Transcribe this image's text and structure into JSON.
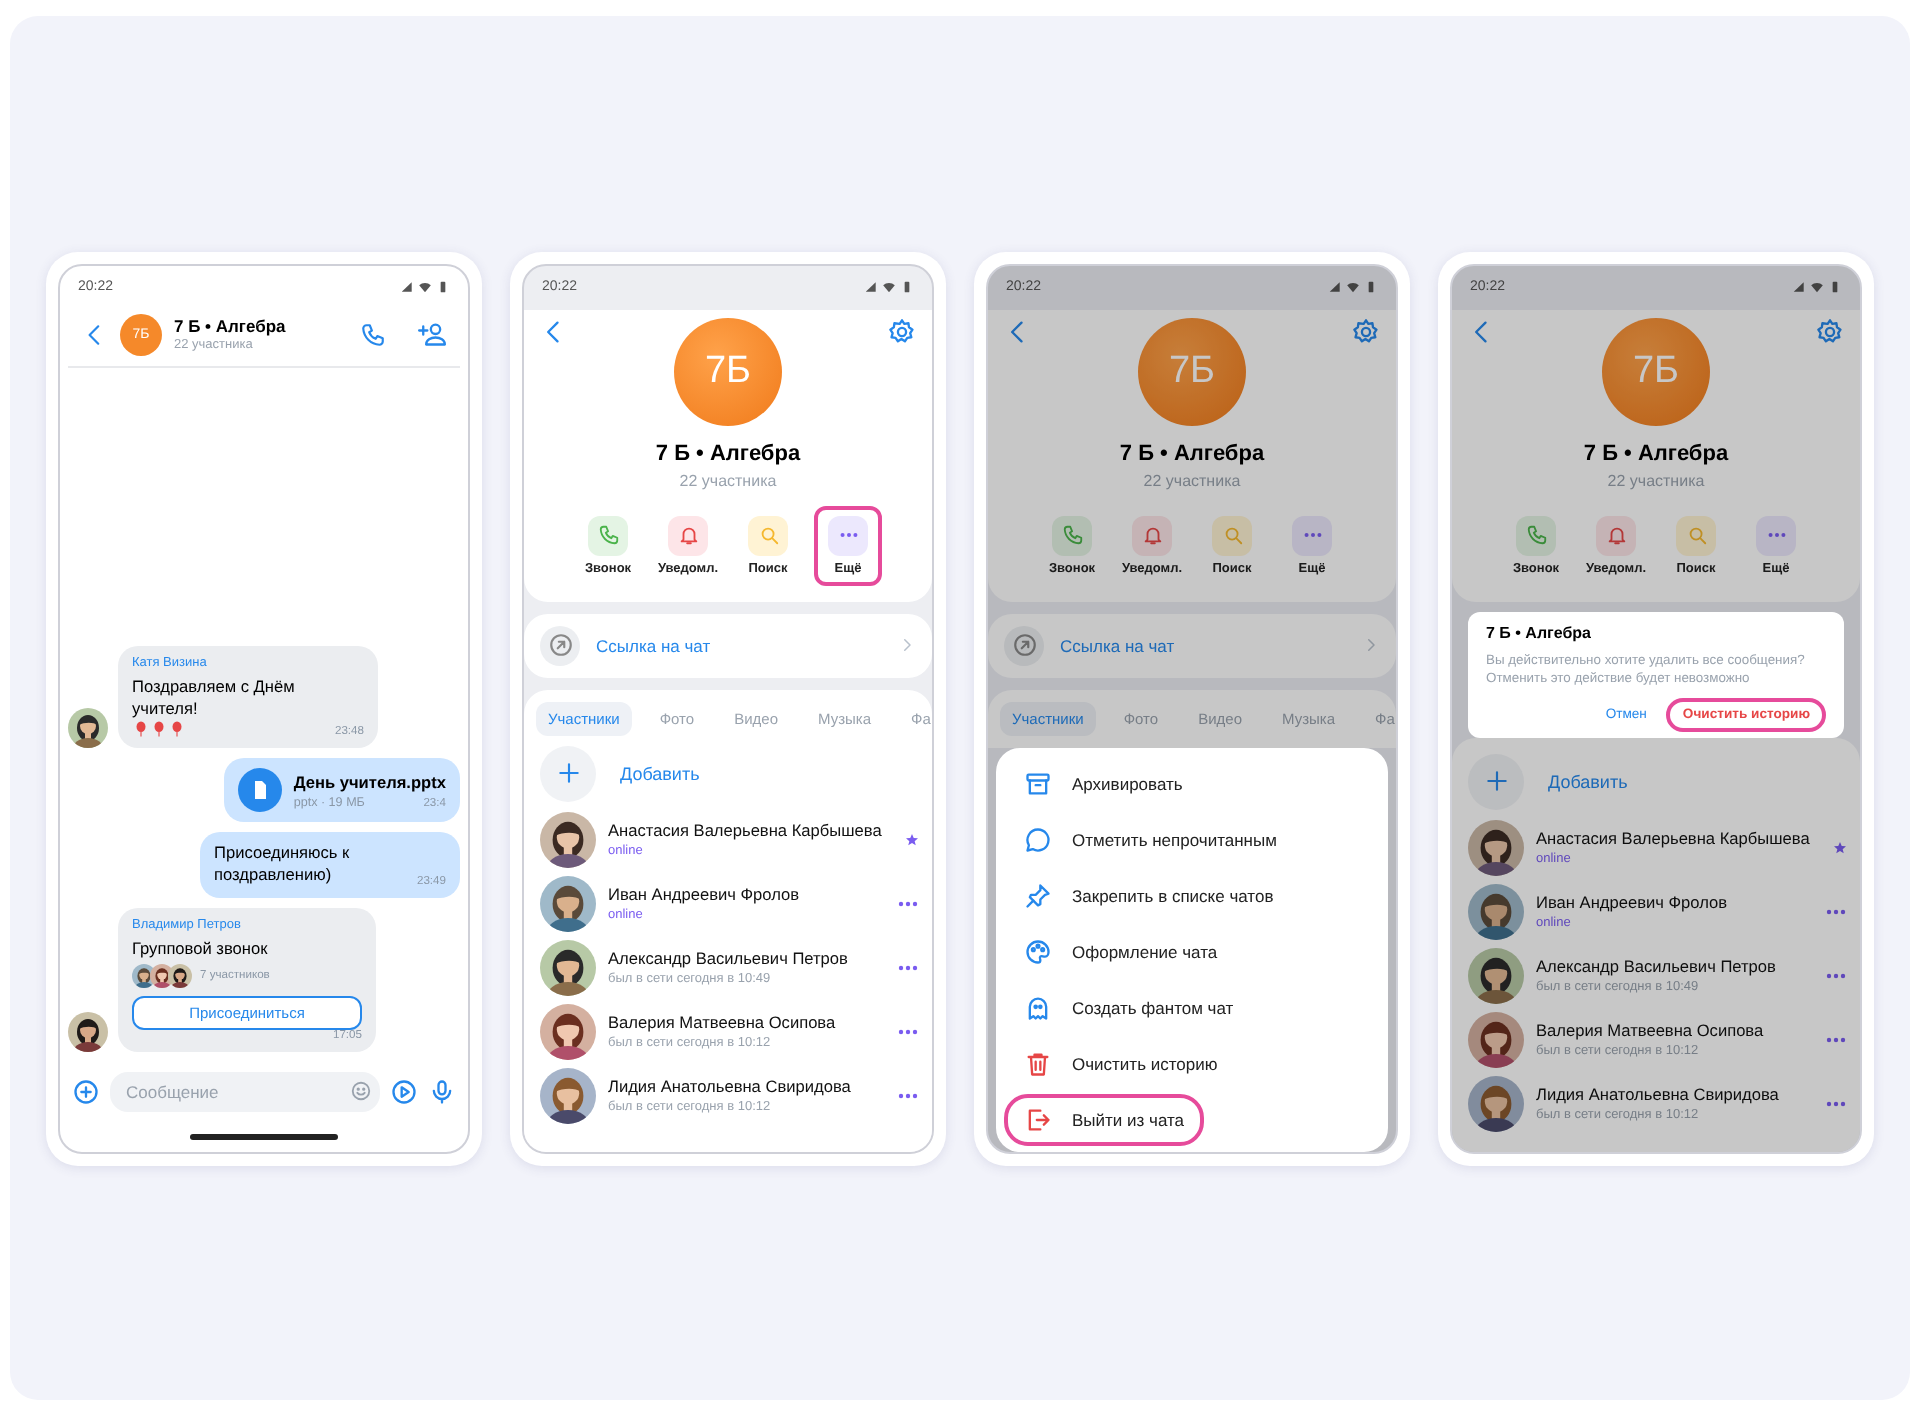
{
  "screens": [
    {
      "kind": "chat",
      "time": "20:22",
      "chat": {
        "avatar": "7Б",
        "title": "7 Б • Алгебра",
        "subtitle": "22 участника"
      },
      "messages": [
        {
          "kind": "text",
          "outgoing": false,
          "author": "Катя Визина",
          "text": "Поздравляем с Днём учителя!",
          "balloons": true,
          "time": "23:48"
        },
        {
          "kind": "file",
          "outgoing": true,
          "file_name": "День учителя.pptx",
          "file_info": "pptx · 19 МБ",
          "time": "23:4"
        },
        {
          "kind": "text",
          "outgoing": true,
          "text": "Присоединяюсь к поздравлению)",
          "balloons": false,
          "time": "23:49"
        },
        {
          "kind": "call",
          "outgoing": false,
          "author": "Владимир Петров",
          "title": "Групповой звонок",
          "participants": "7 участников",
          "button": "Присоединиться",
          "time": "17:05"
        }
      ],
      "composer": {
        "placeholder": "Сообщение"
      }
    },
    {
      "kind": "profile",
      "dimmed": false,
      "time": "20:22",
      "avatar": "7Б",
      "title": "7 Б • Алгебра",
      "subtitle": "22 участника",
      "actions": [
        {
          "kind": "call",
          "label": "Звонок",
          "highlighted": false
        },
        {
          "kind": "notify",
          "label": "Уведомл.",
          "highlighted": false
        },
        {
          "kind": "search",
          "label": "Поиск",
          "highlighted": false
        },
        {
          "kind": "more",
          "label": "Ещё",
          "highlighted": true
        }
      ],
      "link": {
        "label": "Ссылка на чат"
      },
      "tabs": [
        {
          "label": "Участники",
          "selected": true
        },
        {
          "label": "Фото",
          "selected": false
        },
        {
          "label": "Видео",
          "selected": false
        },
        {
          "label": "Музыка",
          "selected": false
        },
        {
          "label": "Фа",
          "selected": false
        }
      ],
      "add_label": "Добавить",
      "members": [
        {
          "kind": "starred",
          "name": "Анастасия Валерьевна Карбышева",
          "status": "online",
          "online": true
        },
        {
          "kind": "regular",
          "name": "Иван Андреевич Фролов",
          "status": "online",
          "online": true
        },
        {
          "kind": "regular",
          "name": "Александр Васильевич Петров",
          "status": "был в сети сегодня в 10:49",
          "online": false
        },
        {
          "kind": "regular",
          "name": "Валерия Матвеевна Осипова",
          "status": "был в сети сегодня в 10:12",
          "online": false
        },
        {
          "kind": "regular",
          "name": "Лидия Анатольевна Свиридова",
          "status": "был в сети сегодня в 10:12",
          "online": false
        }
      ]
    },
    {
      "kind": "profile",
      "dimmed": true,
      "time": "20:22",
      "avatar": "7Б",
      "title": "7 Б • Алгебра",
      "subtitle": "22 участника",
      "actions": [
        {
          "kind": "call",
          "label": "Звонок",
          "highlighted": false
        },
        {
          "kind": "notify",
          "label": "Уведомл.",
          "highlighted": false
        },
        {
          "kind": "search",
          "label": "Поиск",
          "highlighted": false
        },
        {
          "kind": "more",
          "label": "Ещё",
          "highlighted": false
        }
      ],
      "link": {
        "label": "Ссылка на чат"
      },
      "tabs": [
        {
          "label": "Участники",
          "selected": true
        },
        {
          "label": "Фото",
          "selected": false
        },
        {
          "label": "Видео",
          "selected": false
        },
        {
          "label": "Музыка",
          "selected": false
        },
        {
          "label": "Фа",
          "selected": false
        }
      ],
      "menu": [
        {
          "kind": "archive",
          "label": "Архивировать",
          "highlighted": false
        },
        {
          "kind": "unread",
          "label": "Отметить непрочитанным",
          "highlighted": false
        },
        {
          "kind": "pin",
          "label": "Закрепить в списке чатов",
          "highlighted": false
        },
        {
          "kind": "theme",
          "label": "Оформление чата",
          "highlighted": false
        },
        {
          "kind": "phantom",
          "label": "Создать фантом чат",
          "highlighted": false
        },
        {
          "kind": "clear",
          "label": "Очистить историю",
          "highlighted": false
        },
        {
          "kind": "leave",
          "label": "Выйти из чата",
          "highlighted": true
        }
      ]
    },
    {
      "kind": "profile",
      "dimmed": true,
      "time": "20:22",
      "avatar": "7Б",
      "title": "7 Б • Алгебра",
      "subtitle": "22 участника",
      "actions": [
        {
          "kind": "call",
          "label": "Звонок",
          "highlighted": false
        },
        {
          "kind": "notify",
          "label": "Уведомл.",
          "highlighted": false
        },
        {
          "kind": "search",
          "label": "Поиск",
          "highlighted": false
        },
        {
          "kind": "more",
          "label": "Ещё",
          "highlighted": false
        }
      ],
      "dialog": {
        "title": "7 Б • Алгебра",
        "text": "Вы действительно хотите удалить все сообщения? Отменить это действие будет невозможно",
        "buttons": [
          {
            "kind": "cancel",
            "label": "Отмен",
            "highlighted": false
          },
          {
            "kind": "confirm",
            "label": "Очистить историю",
            "highlighted": true
          }
        ]
      },
      "add_label": "Добавить",
      "members": [
        {
          "kind": "starred",
          "name": "Анастасия Валерьевна Карбышева",
          "status": "online",
          "online": true
        },
        {
          "kind": "regular",
          "name": "Иван Андреевич Фролов",
          "status": "online",
          "online": true
        },
        {
          "kind": "regular",
          "name": "Александр Васильевич Петров",
          "status": "был в сети сегодня в 10:49",
          "online": false
        },
        {
          "kind": "regular",
          "name": "Валерия Матвеевна Осипова",
          "status": "был в сети сегодня в 10:12",
          "online": false
        },
        {
          "kind": "regular",
          "name": "Лидия Анатольевна Свиридова",
          "status": "был в сети сегодня в 10:12",
          "online": false
        }
      ]
    }
  ]
}
